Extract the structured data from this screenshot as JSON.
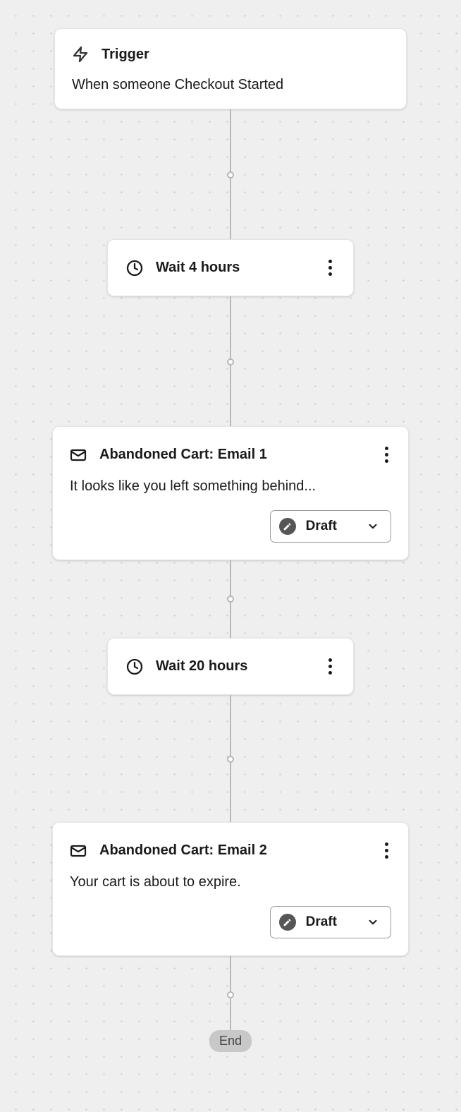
{
  "trigger": {
    "title": "Trigger",
    "description": "When someone Checkout Started"
  },
  "wait1": {
    "label": "Wait 4 hours"
  },
  "email1": {
    "title": "Abandoned Cart: Email 1",
    "description": "It looks like you left something behind...",
    "status": "Draft"
  },
  "wait2": {
    "label": "Wait 20 hours"
  },
  "email2": {
    "title": "Abandoned Cart: Email 2",
    "description": "Your cart is about to expire.",
    "status": "Draft"
  },
  "end": "End"
}
